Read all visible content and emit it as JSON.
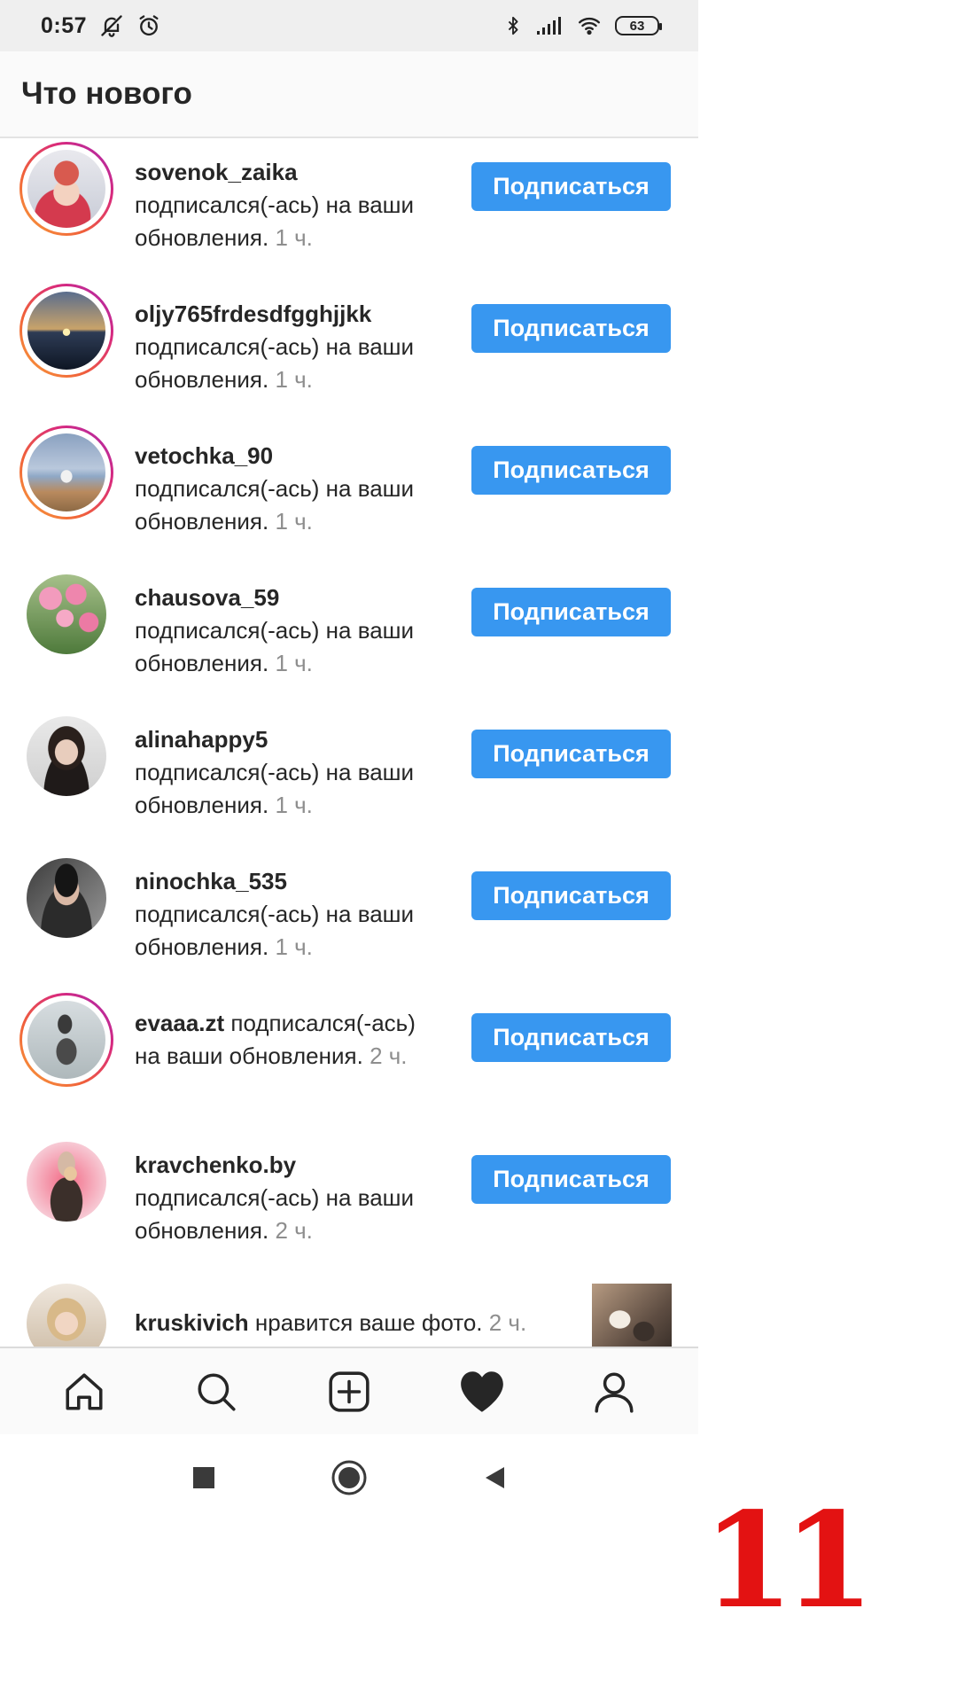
{
  "status_bar": {
    "time": "0:57",
    "icons_left": [
      "mute-bell-icon",
      "alarm-icon"
    ],
    "icons_right": [
      "bluetooth-icon",
      "signal-icon",
      "wifi-icon",
      "battery-icon"
    ],
    "battery": "63"
  },
  "header": {
    "title": "Что нового"
  },
  "feed": {
    "items": [
      {
        "username": "sovenok_zaika",
        "action": "подписался(-ась) на ваши обновления.",
        "time": "1 ч.",
        "button": "Подписаться",
        "story_ring": true
      },
      {
        "username": "oljy765frdesdfgghjjkk",
        "action": "подписался(-ась) на ваши обновления.",
        "time": "1 ч.",
        "button": "Подписаться",
        "story_ring": true
      },
      {
        "username": "vetochka_90",
        "action": "подписался(-ась) на ваши обновления.",
        "time": "1 ч.",
        "button": "Подписаться",
        "story_ring": true
      },
      {
        "username": "chausova_59",
        "action": "подписался(-ась) на ваши обновления.",
        "time": "1 ч.",
        "button": "Подписаться",
        "story_ring": false
      },
      {
        "username": "alinahappy5",
        "action": "подписался(-ась) на ваши обновления.",
        "time": "1 ч.",
        "button": "Подписаться",
        "story_ring": false
      },
      {
        "username": "ninochka_535",
        "action": "подписался(-ась) на ваши обновления.",
        "time": "1 ч.",
        "button": "Подписаться",
        "story_ring": false
      },
      {
        "username": "evaaa.zt",
        "action": "подписался(-ась) на ваши обновления.",
        "time": "2 ч.",
        "button": "Подписаться",
        "story_ring": true
      },
      {
        "username": "kravchenko.by",
        "action": "подписался(-ась) на ваши обновления.",
        "time": "2 ч.",
        "button": "Подписаться",
        "story_ring": false
      },
      {
        "username": "kruskivich",
        "action": "нравится ваше фото.",
        "time": "2 ч.",
        "story_ring": false
      }
    ]
  },
  "bottom_nav": {
    "items": [
      "home-icon",
      "search-icon",
      "add-post-icon",
      "activity-heart-icon",
      "profile-icon"
    ]
  },
  "system_nav": {
    "items": [
      "recents-square-icon",
      "home-circle-icon",
      "back-triangle-icon"
    ]
  },
  "overlay": {
    "number": "11"
  },
  "colors": {
    "follow_button": "#3897f0",
    "overlay_number": "#e31212",
    "time_gray": "#8e8e8e"
  }
}
